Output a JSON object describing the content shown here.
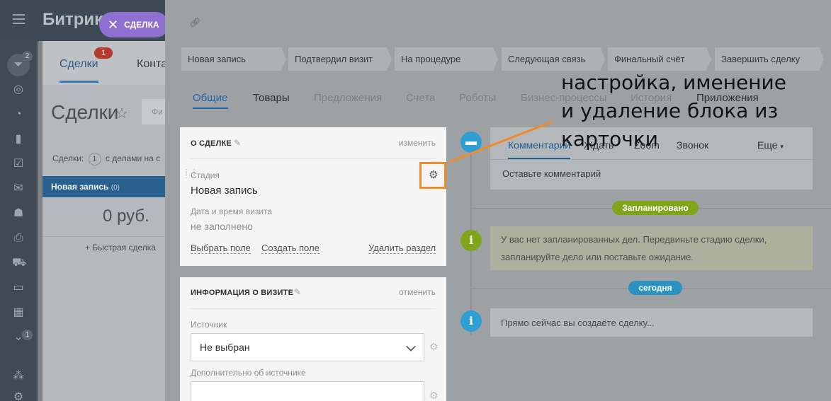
{
  "app": {
    "brand": "Битрик",
    "tabs": [
      {
        "label": "Сделки",
        "badge": "1"
      },
      {
        "label": "Конта"
      }
    ],
    "page_title": "Сделки",
    "filter_placeholder": "Фи",
    "counter": {
      "prefix": "Сделки:",
      "count": "1",
      "suffix": "с делами на с"
    },
    "column": {
      "name": "Новая запись",
      "count": "(0)",
      "sum": "0 руб.",
      "quick_add": "+ Быстрая сделка"
    },
    "rail_badges": [
      "2",
      "1"
    ]
  },
  "slider": {
    "close_label": "СДЕЛКА",
    "stages": [
      "Новая запись",
      "Подтвердил визит",
      "На процедуре",
      "Следующая связь",
      "Финальный счёт",
      "Завершить сделку"
    ],
    "tabs": [
      "Общие",
      "Товары",
      "Предложения",
      "Счета",
      "Роботы",
      "Бизнес-процессы",
      "История",
      "Приложения"
    ],
    "block_about": {
      "title": "О СДЕЛКЕ",
      "action": "изменить",
      "stage_label": "Стадия",
      "stage_value": "Новая запись",
      "visit_label": "Дата и время визита",
      "visit_value": "не заполнено",
      "links": [
        "Выбрать поле",
        "Создать поле",
        "Удалить раздел"
      ]
    },
    "block_visit": {
      "title": "ИНФОРМАЦИЯ О ВИЗИТЕ",
      "action": "отменить",
      "source_label": "Источник",
      "source_value": "Не выбран",
      "extra_label": "Дополнительно об источнике"
    },
    "timeline": {
      "comment_tabs": [
        "Комментарий",
        "Ждать",
        "Zoom",
        "Звонок",
        "Еще"
      ],
      "comment_placeholder": "Оставьте комментарий",
      "planned_badge": "Запланировано",
      "planned_text": "У вас нет запланированных дел. Передвиньте стадию сделки, запланируйте дело или поставьте ожидание.",
      "today_badge": "сегодня",
      "today_text": "Прямо сейчас вы создаёте сделку..."
    }
  },
  "annotation": {
    "text": "настройка, именение и удаление блока из карточки"
  },
  "colors": {
    "accent_orange": "#f08a2b",
    "stage_blue": "#28608e",
    "badge_green": "#8ab81f",
    "badge_blue": "#2ea0d0",
    "close_purple": "#8f6fcf"
  }
}
